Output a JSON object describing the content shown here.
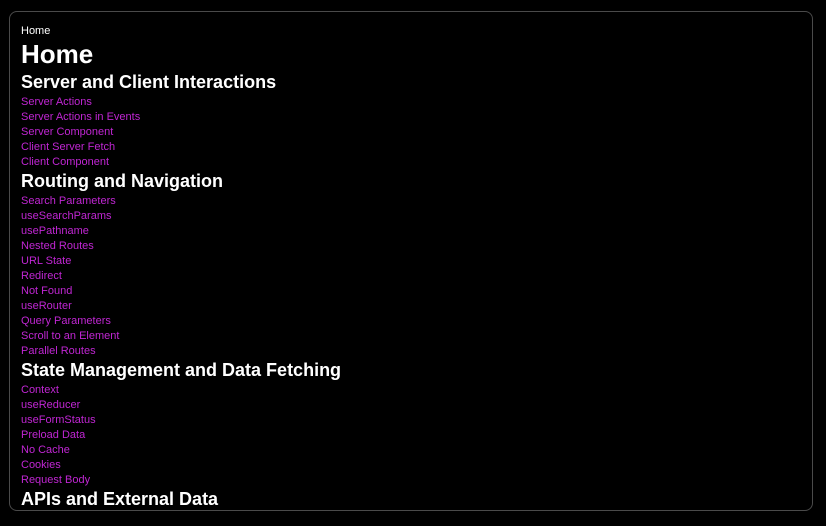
{
  "breadcrumb": "Home",
  "page_title": "Home",
  "colors": {
    "background": "#000000",
    "text": "#ffffff",
    "link": "#c026d3",
    "border": "#4a4a4a"
  },
  "sections": [
    {
      "heading": "Server and Client Interactions",
      "links": [
        "Server Actions",
        "Server Actions in Events",
        "Server Component",
        "Client Server Fetch",
        "Client Component"
      ]
    },
    {
      "heading": "Routing and Navigation",
      "links": [
        "Search Parameters",
        "useSearchParams",
        "usePathname",
        "Nested Routes",
        "URL State",
        "Redirect",
        "Not Found",
        "useRouter",
        "Query Parameters",
        "Scroll to an Element",
        "Parallel Routes"
      ]
    },
    {
      "heading": "State Management and Data Fetching",
      "links": [
        "Context",
        "useReducer",
        "useFormStatus",
        "Preload Data",
        "No Cache",
        "Cookies",
        "Request Body"
      ]
    },
    {
      "heading": "APIs and External Data",
      "links": []
    }
  ]
}
